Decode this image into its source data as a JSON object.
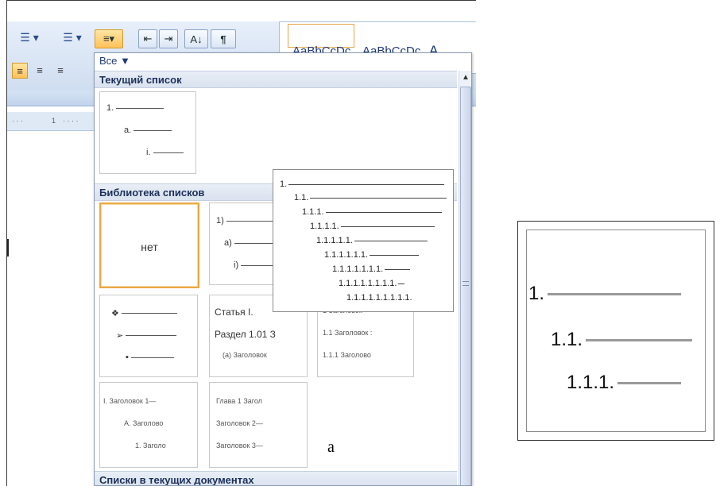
{
  "toolbar": {
    "bullets_label": "☰ ▾",
    "numbering_label": "☰ ▾",
    "multilevel_label": "≡▾",
    "decrease_indent": "⇤",
    "increase_indent": "⇥",
    "sort_label": "A↓",
    "pilcrow": "¶"
  },
  "styles_gallery": {
    "items": [
      "AaBbCcDc",
      "AaBbCcDc",
      "A"
    ]
  },
  "ruler": {
    "marks": [
      "1"
    ]
  },
  "dropdown": {
    "filter_label": "Все ▼",
    "sections": {
      "current": "Текущий список",
      "library": "Библиотека списков",
      "documents": "Списки в текущих документах"
    },
    "current_tile": [
      "1.",
      "a.",
      "i."
    ],
    "none_label": "нет",
    "paren_tile": [
      "1)",
      "a)",
      "i)"
    ],
    "bullet_tile": [
      "❖",
      "➢",
      "▪"
    ],
    "article_tile": [
      "Статья I.",
      "Раздел 1.01 З",
      "(a) Заголовок"
    ],
    "heading_num_tile": [
      "1 Заголовок",
      "1.1 Заголовок :",
      "1.1.1 Заголово"
    ],
    "roman_tile": [
      "I. Заголовок 1—",
      "A. Заголово",
      "1. Заголо"
    ],
    "chapter_tile": [
      "Глава 1 Загол",
      "Заголовок 2—",
      "Заголовок 3—"
    ]
  },
  "tooltip_levels": [
    "1.",
    "1.1.",
    "1.1.1.",
    "1.1.1.1.",
    "1.1.1.1.1.",
    "1.1.1.1.1.1.",
    "1.1.1.1.1.1.1.",
    "1.1.1.1.1.1.1.1.",
    "1.1.1.1.1.1.1.1.1."
  ],
  "caption": "a",
  "zoom_preview": [
    "1.",
    "1.1.",
    "1.1.1."
  ]
}
